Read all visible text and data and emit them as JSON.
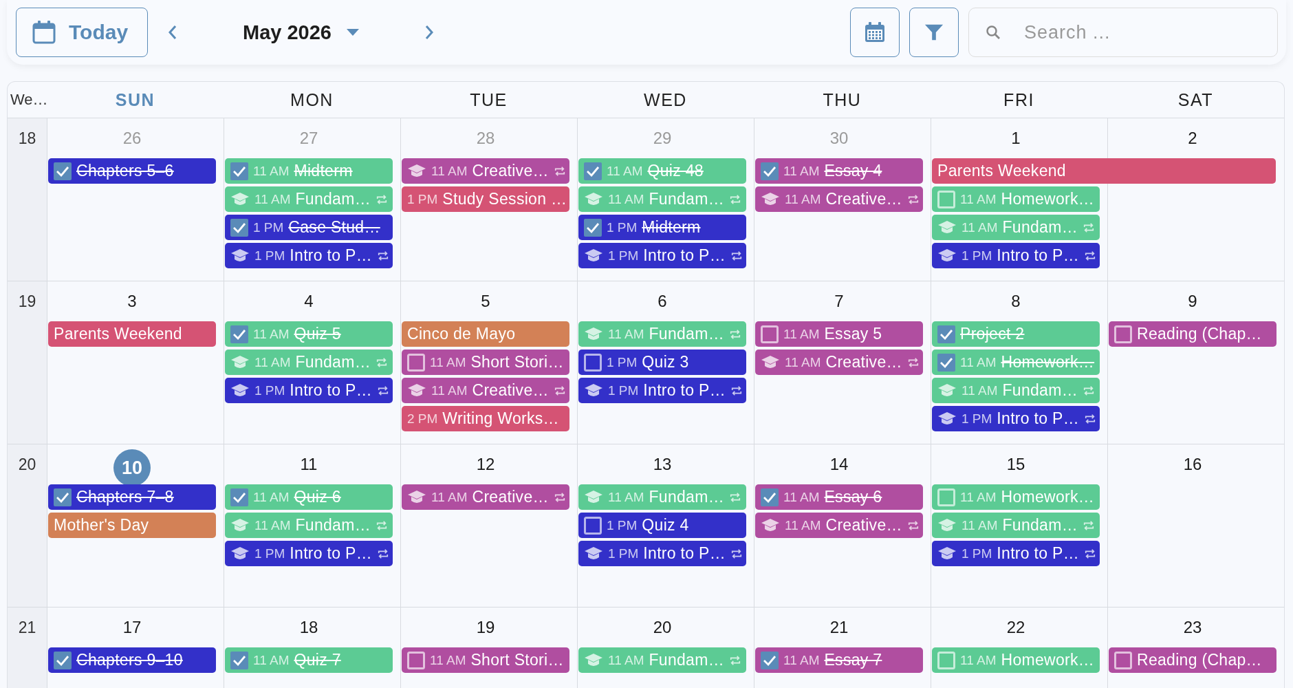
{
  "toolbar": {
    "today_label": "Today",
    "month": "May 2026",
    "search": {
      "placeholder": "Search ..."
    }
  },
  "header": {
    "week_label": "We…",
    "days": [
      {
        "label": "SUN",
        "selected": true
      },
      {
        "label": "MON",
        "selected": false
      },
      {
        "label": "TUE",
        "selected": false
      },
      {
        "label": "WED",
        "selected": false
      },
      {
        "label": "THU",
        "selected": false
      },
      {
        "label": "FRI",
        "selected": false
      },
      {
        "label": "SAT",
        "selected": false
      }
    ]
  },
  "weeks": [
    {
      "number": "18",
      "days": [
        {
          "date": "26",
          "other_month": true,
          "today": false,
          "events": [
            {
              "kind": "task",
              "checked": true,
              "title": "Chapters 5–6",
              "color": "#3330c9"
            }
          ]
        },
        {
          "date": "27",
          "other_month": true,
          "today": false,
          "events": [
            {
              "kind": "task",
              "checked": true,
              "time": "11 AM",
              "title": "Midterm",
              "color": "#5ccb94"
            },
            {
              "kind": "class",
              "recurring": true,
              "time": "11 AM",
              "title": "Fundam…",
              "color": "#5ccb94"
            },
            {
              "kind": "task",
              "checked": true,
              "time": "1 PM",
              "title": "Case Stud…",
              "color": "#3330c9"
            },
            {
              "kind": "class",
              "recurring": true,
              "time": "1 PM",
              "title": "Intro to P…",
              "color": "#3330c9"
            }
          ]
        },
        {
          "date": "28",
          "other_month": true,
          "today": false,
          "events": [
            {
              "kind": "class",
              "recurring": true,
              "time": "11 AM",
              "title": "Creative…",
              "color": "#b04ea0"
            },
            {
              "kind": "event",
              "time": "1 PM",
              "title": "Study Session …",
              "color": "#d55374"
            }
          ]
        },
        {
          "date": "29",
          "other_month": true,
          "today": false,
          "events": [
            {
              "kind": "task",
              "checked": true,
              "time": "11 AM",
              "title": "Quiz 48",
              "color": "#5ccb94"
            },
            {
              "kind": "class",
              "recurring": true,
              "time": "11 AM",
              "title": "Fundam…",
              "color": "#5ccb94"
            },
            {
              "kind": "task",
              "checked": true,
              "time": "1 PM",
              "title": "Midterm",
              "color": "#3330c9"
            },
            {
              "kind": "class",
              "recurring": true,
              "time": "1 PM",
              "title": "Intro to P…",
              "color": "#3330c9"
            }
          ]
        },
        {
          "date": "30",
          "other_month": true,
          "today": false,
          "events": [
            {
              "kind": "task",
              "checked": true,
              "time": "11 AM",
              "title": "Essay 4",
              "color": "#b04ea0"
            },
            {
              "kind": "class",
              "recurring": true,
              "time": "11 AM",
              "title": "Creative…",
              "color": "#b04ea0"
            }
          ]
        },
        {
          "date": "1",
          "other_month": false,
          "today": false,
          "events": [
            {
              "kind": "multiday",
              "title": "Parents Weekend",
              "color": "#d55374"
            },
            {
              "kind": "task",
              "checked": false,
              "time": "11 AM",
              "title": "Homework…",
              "color": "#5ccb94"
            },
            {
              "kind": "class",
              "recurring": true,
              "time": "11 AM",
              "title": "Fundam…",
              "color": "#5ccb94"
            },
            {
              "kind": "class",
              "recurring": true,
              "time": "1 PM",
              "title": "Intro to P…",
              "color": "#3330c9"
            }
          ]
        },
        {
          "date": "2",
          "other_month": false,
          "today": false
        }
      ]
    },
    {
      "number": "19",
      "days": [
        {
          "date": "3",
          "other_month": false,
          "today": false,
          "events": [
            {
              "kind": "event",
              "title": "Parents Weekend",
              "color": "#d55374"
            }
          ]
        },
        {
          "date": "4",
          "other_month": false,
          "today": false,
          "events": [
            {
              "kind": "task",
              "checked": true,
              "time": "11 AM",
              "title": "Quiz 5",
              "color": "#5ccb94"
            },
            {
              "kind": "class",
              "recurring": true,
              "time": "11 AM",
              "title": "Fundam…",
              "color": "#5ccb94"
            },
            {
              "kind": "class",
              "recurring": true,
              "time": "1 PM",
              "title": "Intro to P…",
              "color": "#3330c9"
            }
          ]
        },
        {
          "date": "5",
          "other_month": false,
          "today": false,
          "events": [
            {
              "kind": "event",
              "title": "Cinco de Mayo",
              "color": "#d38156"
            },
            {
              "kind": "task",
              "checked": false,
              "time": "11 AM",
              "title": "Short Stori…",
              "color": "#b04ea0"
            },
            {
              "kind": "class",
              "recurring": true,
              "time": "11 AM",
              "title": "Creative…",
              "color": "#b04ea0"
            },
            {
              "kind": "event",
              "time": "2 PM",
              "title": "Writing Works…",
              "color": "#d55374"
            }
          ]
        },
        {
          "date": "6",
          "other_month": false,
          "today": false,
          "events": [
            {
              "kind": "class",
              "recurring": true,
              "time": "11 AM",
              "title": "Fundam…",
              "color": "#5ccb94"
            },
            {
              "kind": "task",
              "checked": false,
              "time": "1 PM",
              "title": "Quiz 3",
              "color": "#3330c9"
            },
            {
              "kind": "class",
              "recurring": true,
              "time": "1 PM",
              "title": "Intro to P…",
              "color": "#3330c9"
            }
          ]
        },
        {
          "date": "7",
          "other_month": false,
          "today": false,
          "events": [
            {
              "kind": "task",
              "checked": false,
              "time": "11 AM",
              "title": "Essay 5",
              "color": "#b04ea0"
            },
            {
              "kind": "class",
              "recurring": true,
              "time": "11 AM",
              "title": "Creative…",
              "color": "#b04ea0"
            }
          ]
        },
        {
          "date": "8",
          "other_month": false,
          "today": false,
          "events": [
            {
              "kind": "task",
              "checked": true,
              "title": "Project 2",
              "color": "#5ccb94"
            },
            {
              "kind": "task",
              "checked": true,
              "time": "11 AM",
              "title": "Homework…",
              "color": "#5ccb94"
            },
            {
              "kind": "class",
              "recurring": true,
              "time": "11 AM",
              "title": "Fundam…",
              "color": "#5ccb94"
            },
            {
              "kind": "class",
              "recurring": true,
              "time": "1 PM",
              "title": "Intro to P…",
              "color": "#3330c9"
            }
          ]
        },
        {
          "date": "9",
          "other_month": false,
          "today": false,
          "events": [
            {
              "kind": "task",
              "checked": false,
              "title": "Reading (Chap…",
              "color": "#b04ea0"
            }
          ]
        }
      ]
    },
    {
      "number": "20",
      "days": [
        {
          "date": "10",
          "other_month": false,
          "today": true,
          "events": [
            {
              "kind": "task",
              "checked": true,
              "title": "Chapters 7–8",
              "color": "#3330c9"
            },
            {
              "kind": "event",
              "title": "Mother's Day",
              "color": "#d38156"
            }
          ]
        },
        {
          "date": "11",
          "other_month": false,
          "today": false,
          "events": [
            {
              "kind": "task",
              "checked": true,
              "time": "11 AM",
              "title": "Quiz 6",
              "color": "#5ccb94"
            },
            {
              "kind": "class",
              "recurring": true,
              "time": "11 AM",
              "title": "Fundam…",
              "color": "#5ccb94"
            },
            {
              "kind": "class",
              "recurring": true,
              "time": "1 PM",
              "title": "Intro to P…",
              "color": "#3330c9"
            }
          ]
        },
        {
          "date": "12",
          "other_month": false,
          "today": false,
          "events": [
            {
              "kind": "class",
              "recurring": true,
              "time": "11 AM",
              "title": "Creative…",
              "color": "#b04ea0"
            }
          ]
        },
        {
          "date": "13",
          "other_month": false,
          "today": false,
          "events": [
            {
              "kind": "class",
              "recurring": true,
              "time": "11 AM",
              "title": "Fundam…",
              "color": "#5ccb94"
            },
            {
              "kind": "task",
              "checked": false,
              "time": "1 PM",
              "title": "Quiz 4",
              "color": "#3330c9"
            },
            {
              "kind": "class",
              "recurring": true,
              "time": "1 PM",
              "title": "Intro to P…",
              "color": "#3330c9"
            }
          ]
        },
        {
          "date": "14",
          "other_month": false,
          "today": false,
          "events": [
            {
              "kind": "task",
              "checked": true,
              "time": "11 AM",
              "title": "Essay 6",
              "color": "#b04ea0"
            },
            {
              "kind": "class",
              "recurring": true,
              "time": "11 AM",
              "title": "Creative…",
              "color": "#b04ea0"
            }
          ]
        },
        {
          "date": "15",
          "other_month": false,
          "today": false,
          "events": [
            {
              "kind": "task",
              "checked": false,
              "time": "11 AM",
              "title": "Homework…",
              "color": "#5ccb94"
            },
            {
              "kind": "class",
              "recurring": true,
              "time": "11 AM",
              "title": "Fundam…",
              "color": "#5ccb94"
            },
            {
              "kind": "class",
              "recurring": true,
              "time": "1 PM",
              "title": "Intro to P…",
              "color": "#3330c9"
            }
          ]
        },
        {
          "date": "16",
          "other_month": false,
          "today": false
        }
      ]
    },
    {
      "number": "21",
      "days": [
        {
          "date": "17",
          "other_month": false,
          "today": false,
          "events": [
            {
              "kind": "task",
              "checked": true,
              "title": "Chapters 9–10",
              "color": "#3330c9"
            }
          ]
        },
        {
          "date": "18",
          "other_month": false,
          "today": false,
          "events": [
            {
              "kind": "task",
              "checked": true,
              "time": "11 AM",
              "title": "Quiz 7",
              "color": "#5ccb94"
            }
          ]
        },
        {
          "date": "19",
          "other_month": false,
          "today": false,
          "events": [
            {
              "kind": "task",
              "checked": false,
              "time": "11 AM",
              "title": "Short Stori…",
              "color": "#b04ea0"
            }
          ]
        },
        {
          "date": "20",
          "other_month": false,
          "today": false,
          "events": [
            {
              "kind": "class",
              "recurring": true,
              "time": "11 AM",
              "title": "Fundam…",
              "color": "#5ccb94"
            }
          ]
        },
        {
          "date": "21",
          "other_month": false,
          "today": false,
          "events": [
            {
              "kind": "task",
              "checked": true,
              "time": "11 AM",
              "title": "Essay 7",
              "color": "#b04ea0"
            }
          ]
        },
        {
          "date": "22",
          "other_month": false,
          "today": false,
          "events": [
            {
              "kind": "task",
              "checked": false,
              "time": "11 AM",
              "title": "Homework…",
              "color": "#5ccb94"
            }
          ]
        },
        {
          "date": "23",
          "other_month": false,
          "today": false,
          "events": [
            {
              "kind": "task",
              "checked": false,
              "title": "Reading (Chap…",
              "color": "#b04ea0"
            }
          ]
        }
      ]
    }
  ]
}
